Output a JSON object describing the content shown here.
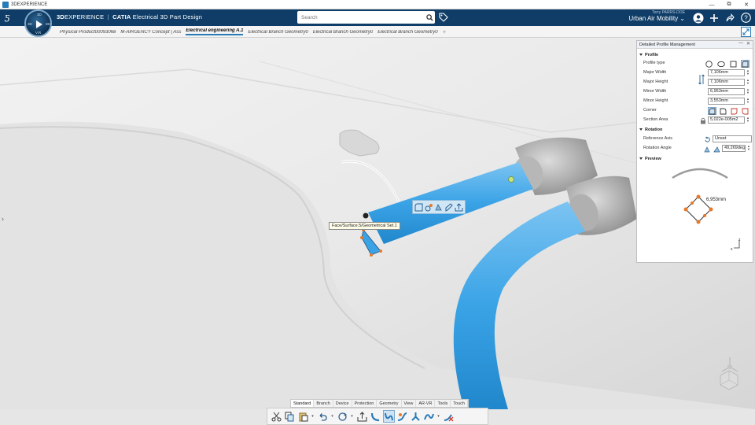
{
  "window": {
    "title": "3DEXPERIENCE",
    "controls": [
      "—",
      "⧉",
      "✕"
    ]
  },
  "topbar": {
    "brand_3d": "3D",
    "brand_experience": "EXPERIENCE",
    "brand_sep": "|",
    "brand_app": "CATIA",
    "brand_role": "Electrical 3D Part Design",
    "search_placeholder": "Search",
    "user_name": "Terry PARRS-DOE",
    "collab_space": "Urban Air Mobility",
    "compass_labels": {
      "top": "3D",
      "left": "3D",
      "right": "3D",
      "bottom": "V,R"
    }
  },
  "tabs": [
    {
      "label": "Physical Product00093068",
      "active": false
    },
    {
      "label": "M-AIRGENCY Concept | Ass",
      "active": false
    },
    {
      "label": "Electrical engineering A.1",
      "active": true
    },
    {
      "label": "Electrical Branch Geometry0",
      "active": false
    },
    {
      "label": "Electrical Branch Geometry0",
      "active": false
    },
    {
      "label": "Electrical Branch Geometry0",
      "active": false
    }
  ],
  "tooltip": "Face/Surface.5/Geometrical Set.1",
  "panel": {
    "title": "Detailed Profile Management",
    "profile": {
      "heading": "Profile",
      "profile_type_label": "Profile type",
      "major_width_label": "Major Width",
      "major_width": "7,106mm",
      "major_height_label": "Major Height",
      "major_height": "7,106mm",
      "minor_width_label": "Minor Width",
      "minor_width": "6,953mm",
      "minor_height_label": "Minor Height",
      "minor_height": "3,553mm",
      "corner_label": "Corner",
      "section_area_label": "Section Area",
      "section_area": "5,022e-005m2"
    },
    "rotation": {
      "heading": "Rotation",
      "reference_axis_label": "Reference Axis",
      "reference_axis": "Unset",
      "rotation_angle_label": "Rotation Angle",
      "rotation_angle": "49,269deg"
    },
    "preview": {
      "heading": "Preview",
      "dimension": "6,953mm",
      "axis_z": "z",
      "axis_x": "x"
    }
  },
  "action_tabs": [
    {
      "label": "Standard",
      "active": true
    },
    {
      "label": "Branch",
      "active": false
    },
    {
      "label": "Device",
      "active": false
    },
    {
      "label": "Protection",
      "active": false
    },
    {
      "label": "Geometry",
      "active": false
    },
    {
      "label": "View",
      "active": false
    },
    {
      "label": "AR-VR",
      "active": false
    },
    {
      "label": "Tools",
      "active": false
    },
    {
      "label": "Touch",
      "active": false
    }
  ],
  "colors": {
    "topbar": "#0f3d67",
    "accent": "#2a7ab8",
    "tube": "#3aa3e6",
    "handle": "#e8782a"
  }
}
